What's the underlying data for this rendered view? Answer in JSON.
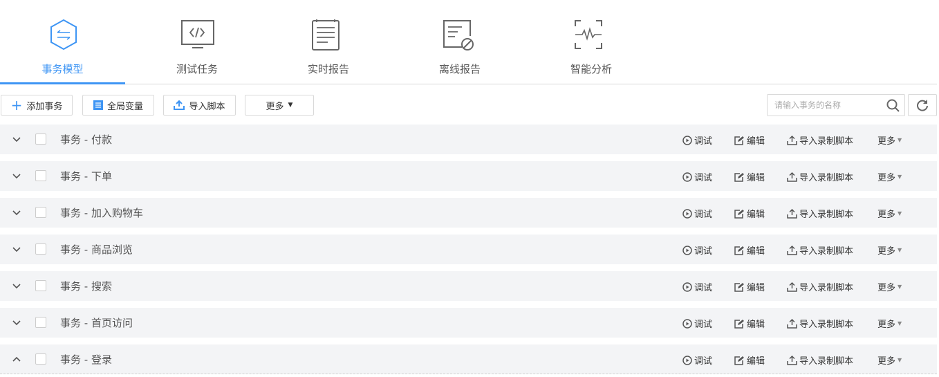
{
  "tabs": [
    {
      "label": "事务模型",
      "icon": "hexagon-swap-icon",
      "active": true
    },
    {
      "label": "测试任务",
      "icon": "monitor-code-icon"
    },
    {
      "label": "实时报告",
      "icon": "document-list-icon"
    },
    {
      "label": "离线报告",
      "icon": "document-blocked-icon"
    },
    {
      "label": "智能分析",
      "icon": "scan-pulse-icon"
    }
  ],
  "toolbar": {
    "add": "添加事务",
    "globals": "全局变量",
    "import": "导入脚本",
    "more": "更多",
    "search_placeholder": "请输入事务的名称"
  },
  "row_actions": {
    "debug": "调试",
    "edit": "编辑",
    "import_record": "导入录制脚本",
    "more": "更多"
  },
  "rows": [
    {
      "name": "事务 - 付款"
    },
    {
      "name": "事务 - 下单"
    },
    {
      "name": "事务 - 加入购物车"
    },
    {
      "name": "事务 - 商品浏览"
    },
    {
      "name": "事务 - 搜索"
    },
    {
      "name": "事务 - 首页访问"
    },
    {
      "name": "事务 - 登录",
      "expanded": true
    }
  ],
  "colors": {
    "accent": "#3e95f4",
    "row_bg": "#f3f4f6"
  }
}
